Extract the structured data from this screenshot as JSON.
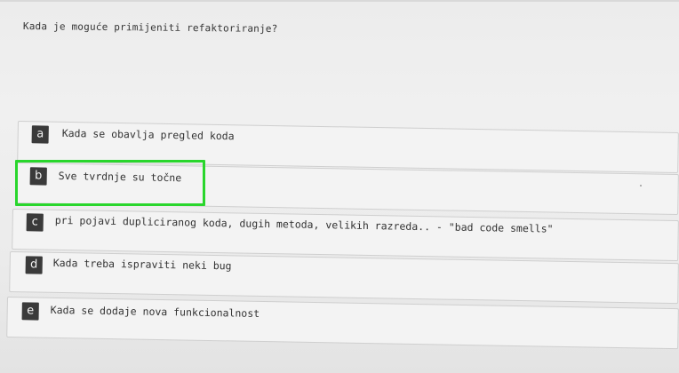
{
  "quiz": {
    "question": "Kada je moguće primijeniti refaktoriranje?",
    "highlight_color": "#29d62c",
    "answers": [
      {
        "letter": "a",
        "text": "Kada se obavlja pregled koda",
        "selected": false
      },
      {
        "letter": "b",
        "text": "Sve tvrdnje su točne",
        "selected": true
      },
      {
        "letter": "c",
        "text": "pri pojavi dupliciranog koda, dugih metoda, velikih razreda.. - \"bad code smells\"",
        "selected": false
      },
      {
        "letter": "d",
        "text": "Kada treba ispraviti neki bug",
        "selected": false
      },
      {
        "letter": "e",
        "text": "Kada se dodaje nova funkcionalnost",
        "selected": false
      }
    ]
  }
}
